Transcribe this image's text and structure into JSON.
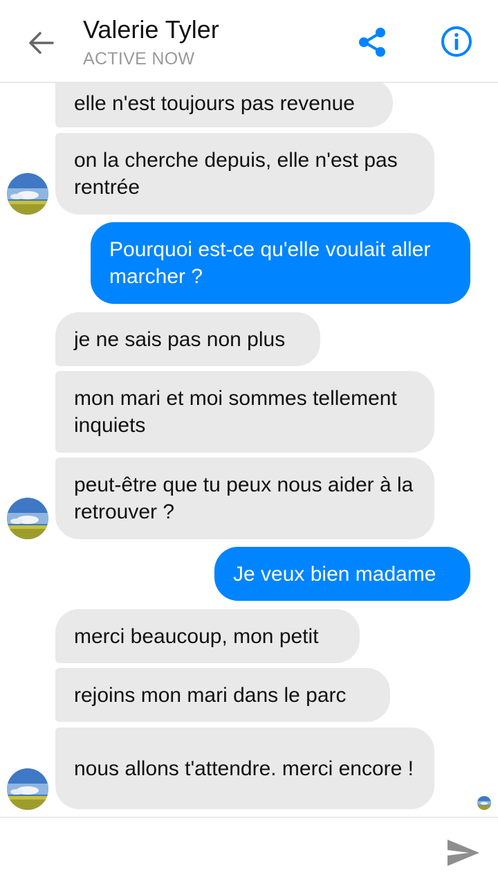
{
  "header": {
    "contact_name": "Valerie Tyler",
    "status": "ACTIVE NOW",
    "icons": {
      "back": "arrow-left-icon",
      "share": "share-icon",
      "info": "info-icon"
    }
  },
  "colors": {
    "accent": "#0084ff",
    "incoming_bubble": "#e9e9e9",
    "status_text": "#9a9a9a"
  },
  "messages": [
    {
      "from": "them",
      "text": "elle n'est toujours pas revenue"
    },
    {
      "from": "them",
      "text": "on la cherche depuis, elle n'est pas rentrée"
    },
    {
      "from": "me",
      "text": "Pourquoi est-ce qu'elle voulait aller marcher ?"
    },
    {
      "from": "them",
      "text": "je ne sais pas non plus"
    },
    {
      "from": "them",
      "text": "mon mari et moi sommes tellement inquiets"
    },
    {
      "from": "them",
      "text": "peut-être que tu peux nous aider à la retrouver ?"
    },
    {
      "from": "me",
      "text": "Je veux bien madame"
    },
    {
      "from": "them",
      "text": "merci beaucoup, mon petit"
    },
    {
      "from": "them",
      "text": "rejoins mon mari dans le parc"
    },
    {
      "from": "them",
      "text": "nous allons t'attendre. merci encore !"
    }
  ],
  "composer": {
    "send_icon": "send-icon"
  }
}
